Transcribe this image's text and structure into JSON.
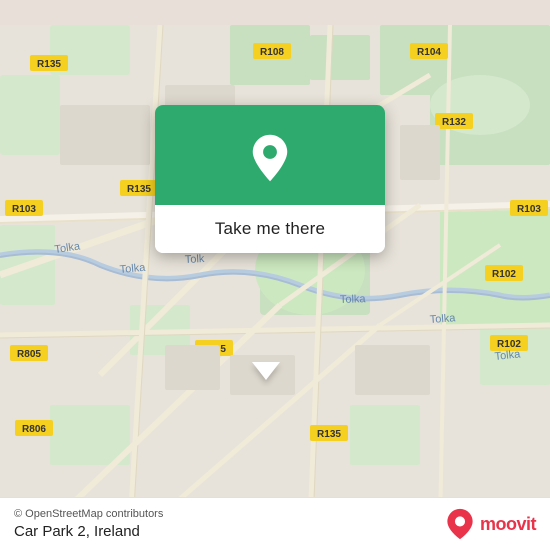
{
  "map": {
    "attribution": "© OpenStreetMap contributors",
    "location_label": "Car Park 2, Ireland",
    "moovit_brand": "moovit"
  },
  "popup": {
    "button_label": "Take me there"
  },
  "colors": {
    "green": "#2eaa6e",
    "moovit_red": "#e8334a"
  }
}
